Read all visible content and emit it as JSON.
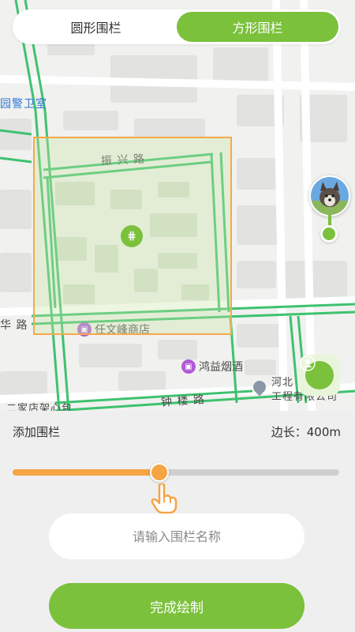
{
  "tabs": [
    {
      "label": "圆形围栏",
      "active": false
    },
    {
      "label": "方形围栏",
      "active": true
    }
  ],
  "map": {
    "labels": {
      "road_top": "振 兴 路",
      "road_left": "华 路",
      "road_bottom": "钟 楼 路",
      "building_blue": "园警卫室",
      "bottom_left": "二家店架心包",
      "bottom_right_1": "河北",
      "bottom_right_2": "工程有限公司",
      "bottom_right_cut": "限公"
    },
    "pois": [
      {
        "label": "任文峰商店",
        "icon": "shop-icon",
        "color": "#b05bd6"
      },
      {
        "label": "鸿益烟酒",
        "icon": "store-icon",
        "color": "#b05bd6"
      }
    ]
  },
  "panel": {
    "add_fence_label": "添加围栏",
    "side_length_label": "边长：400m",
    "slider_value": 0.45,
    "input_placeholder": "请输入围栏名称",
    "finish_button": "完成绘制"
  },
  "colors": {
    "accent_green": "#7bc13c",
    "accent_orange": "#f6a444"
  }
}
